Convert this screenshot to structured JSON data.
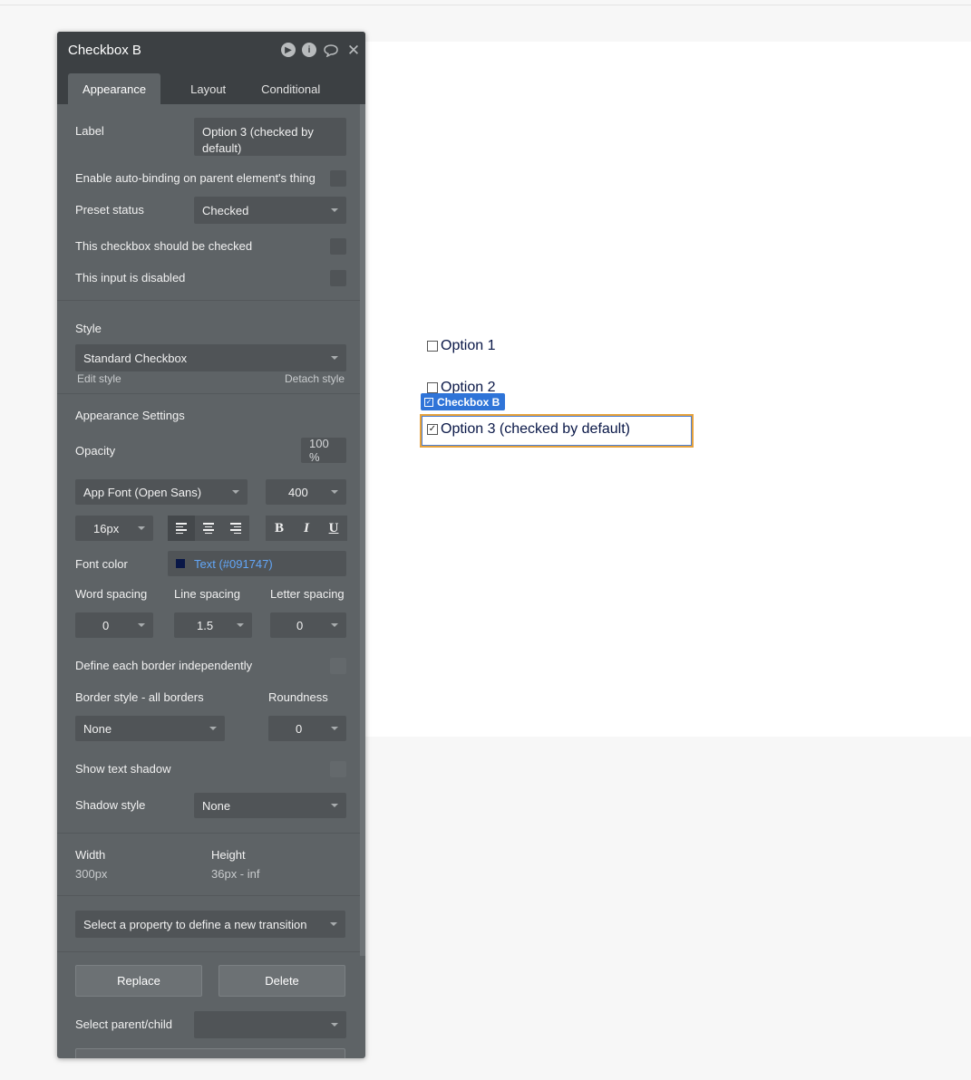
{
  "canvas": {
    "options": [
      "Option 1",
      "Option 2",
      "Option 3 (checked by default)"
    ],
    "selected_tag": "Checkbox B"
  },
  "panel": {
    "title": "Checkbox B",
    "tabs": [
      "Appearance",
      "Layout",
      "Conditional"
    ],
    "label_field": {
      "label": "Label",
      "value": "Option 3 (checked by default)"
    },
    "autobinding_label": "Enable auto-binding on parent element's thing",
    "preset_status": {
      "label": "Preset status",
      "value": "Checked"
    },
    "should_be_checked_label": "This checkbox should be checked",
    "disabled_label": "This input is disabled",
    "style": {
      "label": "Style",
      "value": "Standard Checkbox",
      "edit": "Edit style",
      "detach": "Detach style"
    },
    "appearance_settings": "Appearance Settings",
    "opacity": {
      "label": "Opacity",
      "value": "100 %"
    },
    "font": {
      "family": "App Font (Open Sans)",
      "weight": "400",
      "size": "16px"
    },
    "format": {
      "bold": "B",
      "italic": "I",
      "underline": "U"
    },
    "font_color": {
      "label": "Font color",
      "value": "Text (#091747)",
      "swatch": "#091747"
    },
    "spacing": {
      "word_label": "Word spacing",
      "word_value": "0",
      "line_label": "Line spacing",
      "line_value": "1.5",
      "letter_label": "Letter spacing",
      "letter_value": "0"
    },
    "border_independent_label": "Define each border independently",
    "border": {
      "style_label": "Border style - all borders",
      "style_value": "None",
      "roundness_label": "Roundness",
      "roundness_value": "0"
    },
    "text_shadow_label": "Show text shadow",
    "shadow": {
      "label": "Shadow style",
      "value": "None"
    },
    "size": {
      "width_label": "Width",
      "width_value": "300px",
      "height_label": "Height",
      "height_value": "36px - inf"
    },
    "transition_placeholder": "Select a property to define a new transition",
    "buttons": {
      "replace": "Replace",
      "delete": "Delete"
    },
    "parent_child_label": "Select parent/child"
  },
  "colors": {
    "text": "#091747",
    "panel_bg": "#5e6366",
    "header_bg": "#3c4043",
    "select_tag": "#2f74d8",
    "select_frame": "#e6a23c"
  }
}
